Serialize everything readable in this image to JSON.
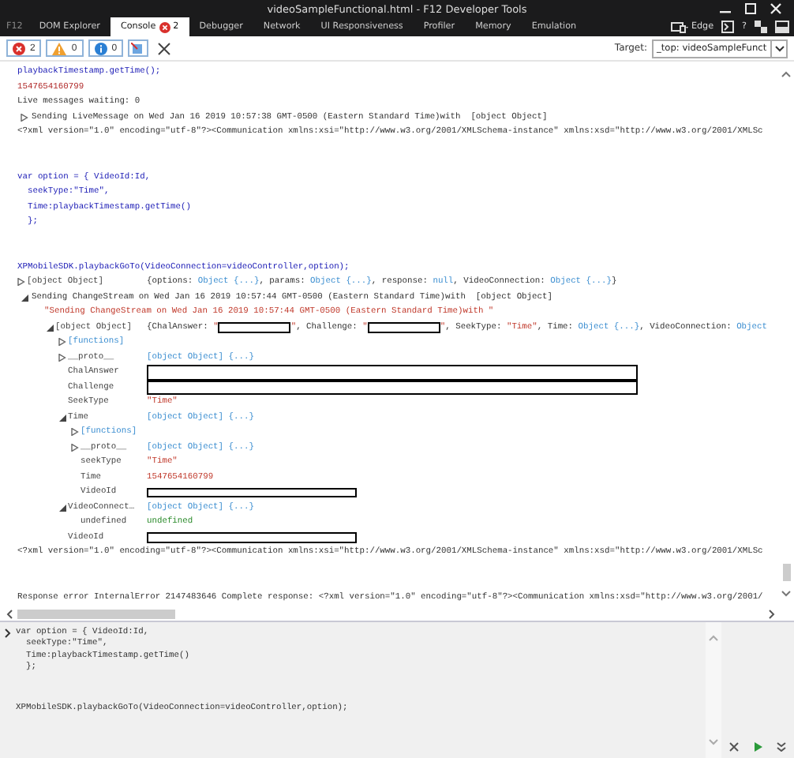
{
  "window": {
    "title": "videoSampleFunctional.html - F12 Developer Tools"
  },
  "brand": "F12",
  "tabs": [
    {
      "label": "DOM Explorer",
      "selected": false
    },
    {
      "label": "Console",
      "selected": true,
      "error_count": "2"
    },
    {
      "label": "Debugger",
      "selected": false
    },
    {
      "label": "Network",
      "selected": false
    },
    {
      "label": "UI Responsiveness",
      "selected": false
    },
    {
      "label": "Profiler",
      "selected": false
    },
    {
      "label": "Memory",
      "selected": false
    },
    {
      "label": "Emulation",
      "selected": false
    }
  ],
  "browser_mode": "Edge",
  "help": "?",
  "filters": [
    {
      "kind": "error",
      "count": "2"
    },
    {
      "kind": "warning",
      "count": "0"
    },
    {
      "kind": "info",
      "count": "0"
    }
  ],
  "target": {
    "label": "Target:",
    "value": "_top: videoSampleFunct"
  },
  "console": {
    "entries": [
      {
        "kind": "input",
        "lines": [
          "playbackTimestamp.getTime();"
        ]
      },
      {
        "kind": "result",
        "text": "1547654160799"
      },
      {
        "kind": "log",
        "text": "Live messages waiting: 0"
      },
      {
        "kind": "log",
        "text": "Sending LiveMessage on Wed Jan 16 2019 10:57:38 GMT-0500 (Eastern Standard Time)with  [object Object]",
        "expanded": false
      },
      {
        "kind": "xml",
        "text": "<?xml version=\"1.0\" encoding=\"utf-8\"?><Communication xmlns:xsi=\"http://www.w3.org/2001/XMLSchema-instance\" xmlns:xsd=\"http://www.w3.org/2001/XMLSc"
      },
      {
        "kind": "input",
        "lines": [
          "var option = { VideoId:Id,",
          "  seekType:\"Time\",",
          "  Time:playbackTimestamp.getTime()",
          "  };"
        ]
      },
      {
        "kind": "input",
        "lines": [
          "XPMobileSDK.playbackGoTo(VideoConnection=videoController,option);"
        ]
      },
      {
        "kind": "object",
        "name": "[object Object]",
        "expanded": false,
        "value": [
          {
            "kind": "plain",
            "text": "{options: "
          },
          {
            "kind": "object",
            "text": "Object {...}"
          },
          {
            "kind": "plain",
            "text": ", params: "
          },
          {
            "kind": "object",
            "text": "Object {...}"
          },
          {
            "kind": "plain",
            "text": ", response: "
          },
          {
            "kind": "object",
            "text": "null"
          },
          {
            "kind": "plain",
            "text": ", VideoConnection: "
          },
          {
            "kind": "object",
            "text": "Object {...}"
          },
          {
            "kind": "plain",
            "text": "}"
          }
        ]
      },
      {
        "kind": "log",
        "text": "Sending ChangeStream on Wed Jan 16 2019 10:57:44 GMT-0500 (Eastern Standard Time)with  [object Object]",
        "expanded": true,
        "children": [
          {
            "kind": "string",
            "text": "\"Sending ChangeStream on Wed Jan 16 2019 10:57:44 GMT-0500 (Eastern Standard Time)with \""
          },
          {
            "kind": "property",
            "name": "[object Object]",
            "expanded": true,
            "value": [
              {
                "kind": "plain",
                "text": "{ChalAnswer: "
              },
              {
                "kind": "string",
                "text": "\""
              },
              {
                "kind": "redacted"
              },
              {
                "kind": "string",
                "text": "\""
              },
              {
                "kind": "plain",
                "text": ", Challenge: "
              },
              {
                "kind": "string",
                "text": "\""
              },
              {
                "kind": "redacted"
              },
              {
                "kind": "string",
                "text": "\""
              },
              {
                "kind": "plain",
                "text": ", SeekType: "
              },
              {
                "kind": "string",
                "text": "\"Time\""
              },
              {
                "kind": "plain",
                "text": ", Time: "
              },
              {
                "kind": "object",
                "text": "Object {...}"
              },
              {
                "kind": "plain",
                "text": ", VideoConnection: "
              },
              {
                "kind": "object",
                "text": "Object"
              }
            ],
            "children": [
              {
                "kind": "functions",
                "name": "[functions]",
                "expanded": false
              },
              {
                "kind": "property",
                "name": "__proto__",
                "expanded": false,
                "value": [
                  {
                    "kind": "object",
                    "text": "[object Object] {...}"
                  }
                ]
              },
              {
                "kind": "property",
                "name": "ChalAnswer",
                "value": [
                  {
                    "kind": "redacted-block"
                  }
                ]
              },
              {
                "kind": "property",
                "name": "Challenge",
                "value": [
                  {
                    "kind": "redacted-block"
                  }
                ]
              },
              {
                "kind": "property",
                "name": "SeekType",
                "value": [
                  {
                    "kind": "string",
                    "text": "\"Time\""
                  }
                ]
              },
              {
                "kind": "property",
                "name": "Time",
                "expanded": true,
                "value": [
                  {
                    "kind": "object",
                    "text": "[object Object] {...}"
                  }
                ],
                "children": [
                  {
                    "kind": "functions",
                    "name": "[functions]",
                    "expanded": false
                  },
                  {
                    "kind": "property",
                    "name": "__proto__",
                    "expanded": false,
                    "value": [
                      {
                        "kind": "object",
                        "text": "[object Object] {...}"
                      }
                    ]
                  },
                  {
                    "kind": "property",
                    "name": "seekType",
                    "value": [
                      {
                        "kind": "string",
                        "text": "\"Time\""
                      }
                    ]
                  },
                  {
                    "kind": "property",
                    "name": "Time",
                    "value": [
                      {
                        "kind": "number",
                        "text": "1547654160799"
                      }
                    ]
                  },
                  {
                    "kind": "property",
                    "name": "VideoId",
                    "value": [
                      {
                        "kind": "redacted"
                      }
                    ]
                  }
                ]
              },
              {
                "kind": "property",
                "name": "VideoConnect…",
                "expanded": true,
                "value": [
                  {
                    "kind": "object",
                    "text": "[object Object] {...}"
                  }
                ],
                "children": [
                  {
                    "kind": "property",
                    "name": "undefined",
                    "value": [
                      {
                        "kind": "undefined",
                        "text": "undefined"
                      }
                    ]
                  }
                ]
              },
              {
                "kind": "property",
                "name": "VideoId",
                "value": [
                  {
                    "kind": "redacted"
                  }
                ]
              }
            ]
          }
        ]
      },
      {
        "kind": "xml",
        "text": "<?xml version=\"1.0\" encoding=\"utf-8\"?><Communication xmlns:xsi=\"http://www.w3.org/2001/XMLSchema-instance\" xmlns:xsd=\"http://www.w3.org/2001/XMLSc"
      },
      {
        "kind": "error",
        "text": "Response error InternalError 2147483646 Complete response: <?xml version=\"1.0\" encoding=\"utf-8\"?><Communication xmlns:xsd=\"http://www.w3.org/2001/"
      }
    ]
  },
  "input": {
    "blocks": [
      [
        "var option = { VideoId:Id,",
        "  seekType:\"Time\",",
        "  Time:playbackTimestamp.getTime()",
        "  };"
      ],
      [
        "XPMobileSDK.playbackGoTo(VideoConnection=videoController,option);"
      ]
    ]
  }
}
